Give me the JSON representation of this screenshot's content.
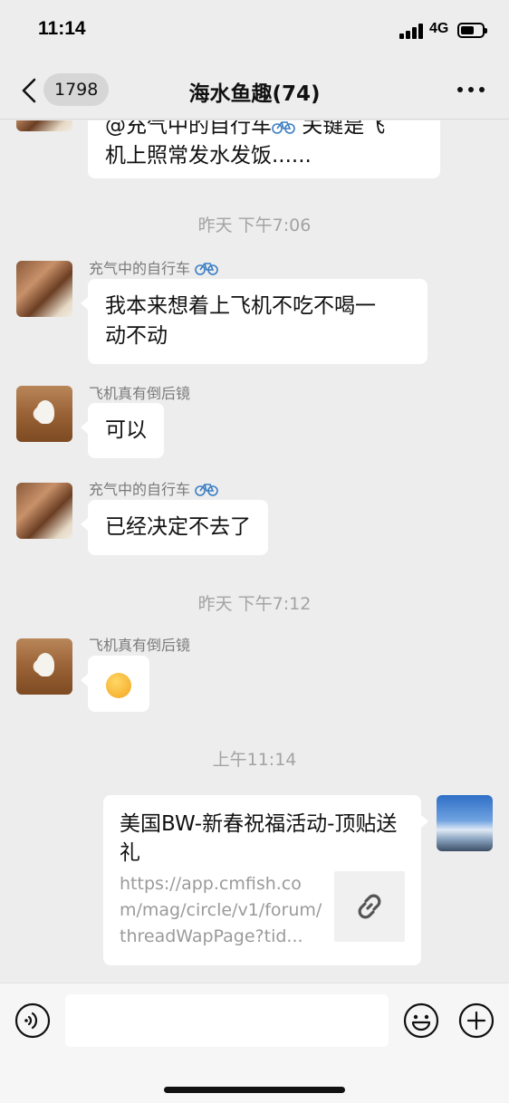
{
  "status_bar": {
    "time": "11:14",
    "network": "4G"
  },
  "nav": {
    "unread_count": "1798",
    "title": "海水鱼趣(74)"
  },
  "messages": {
    "partial": {
      "line1": "@充气中的自行车",
      "line1_tail": " 关键是飞",
      "line2": "机上照常发水发饭......"
    },
    "ts1": "昨天 下午7:06",
    "m1": {
      "sender": "充气中的自行车",
      "line1": "我本来想着上飞机不吃不喝一",
      "line2": "动不动"
    },
    "m2": {
      "sender": "飞机真有倒后镜",
      "text": "可以"
    },
    "m3": {
      "sender": "充气中的自行车",
      "text": "已经决定不去了"
    },
    "ts2": "昨天 下午7:12",
    "m4": {
      "sender": "飞机真有倒后镜"
    },
    "ts3": "上午11:14",
    "link_card": {
      "title": "美国BW-新春祝福活动-顶贴送礼",
      "url": "https://app.cmfish.com/mag/circle/v1/forum/threadWapPage?tid..."
    }
  },
  "icons": {
    "bike": "bicycle-icon",
    "thinking": "thinking-face-emoji",
    "link": "link-icon",
    "voice": "voice-icon",
    "emoji": "emoji-icon",
    "plus": "plus-icon"
  },
  "colors": {
    "background": "#ededed",
    "bubble": "#ffffff",
    "timestamp": "#a3a3a3"
  }
}
